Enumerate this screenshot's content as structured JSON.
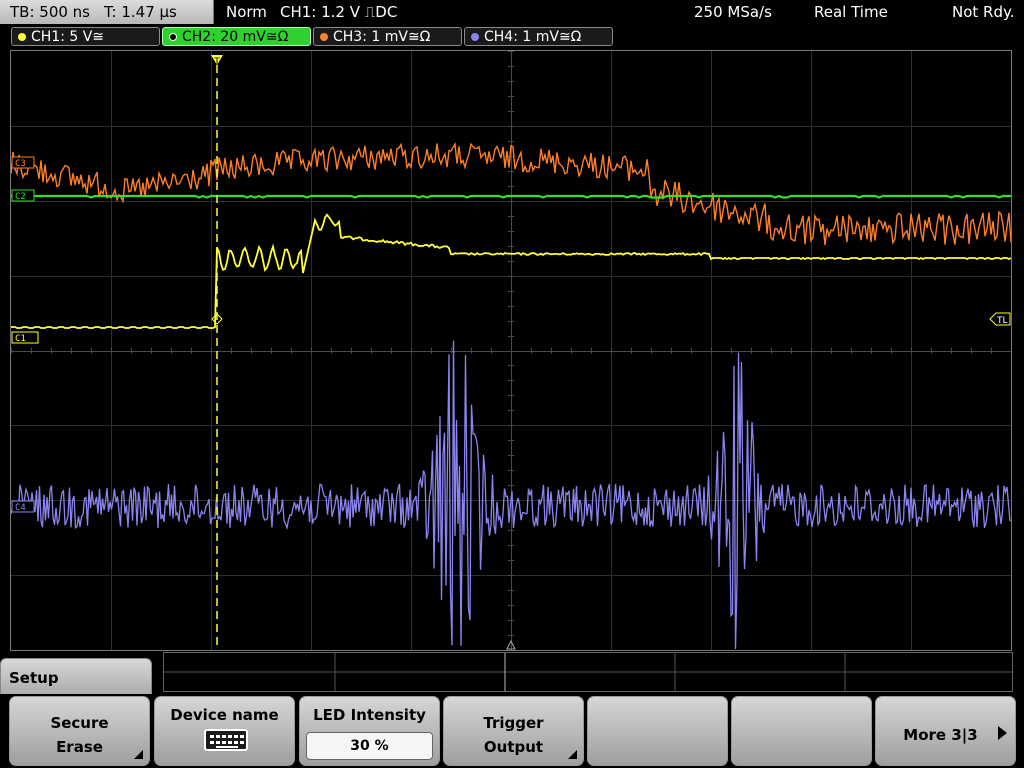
{
  "status": {
    "timebase": "TB: 500 ns",
    "trigger_time": "T: 1.47 µs",
    "trigger_mode": "Norm",
    "trigger_source": "CH1: 1.2 V ⎍DC",
    "sample_rate": "250 MSa/s",
    "acq_mode": "Real Time",
    "ready_state": "Not Rdy."
  },
  "channels": [
    {
      "label": "CH1: 5 V≅",
      "color": "#ffff33",
      "active": false
    },
    {
      "label": "CH2: 20 mV≅Ω",
      "color": "#33dd33",
      "active": true
    },
    {
      "label": "CH3: 1 mV≅Ω",
      "color": "#ff7f27",
      "active": false
    },
    {
      "label": "CH4: 1 mV≅Ω",
      "color": "#8a85ee",
      "active": false
    }
  ],
  "markers": {
    "ch1": "C1",
    "ch2": "C2",
    "ch3": "C3",
    "ch4": "C4",
    "trigger_level": "TL",
    "trigger_pos": "T"
  },
  "menu": {
    "title": "Setup",
    "softkeys": [
      {
        "line1": "Secure",
        "line2": "Erase",
        "icon": "corner-triangle"
      },
      {
        "line1": "Device name",
        "icon": "keyboard-icon"
      },
      {
        "line1": "LED Intensity",
        "value": "30 %"
      },
      {
        "line1": "Trigger",
        "line2": "Output",
        "icon": "corner-triangle"
      },
      {
        "line1": ""
      },
      {
        "line1": ""
      },
      {
        "line1": "More 3|3",
        "icon": "right-arrow-icon"
      }
    ]
  }
}
